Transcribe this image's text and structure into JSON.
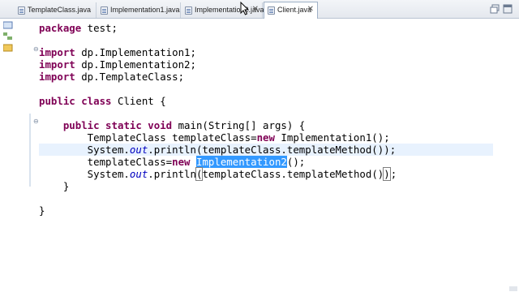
{
  "tabs": [
    {
      "label": "TemplateClass.java",
      "active": false,
      "closable": false
    },
    {
      "label": "Implementation1.java",
      "active": false,
      "closable": false
    },
    {
      "label": "Implementation2.java",
      "active": false,
      "closable": true,
      "close_label": "✕"
    },
    {
      "label": "Client.java",
      "active": true,
      "closable": true,
      "close_label": "✕"
    }
  ],
  "editor": {
    "current_line": 10,
    "selected_text": "Implementation2",
    "lines": [
      {
        "segments": [
          {
            "t": "kw",
            "v": "package"
          },
          {
            "t": "n",
            "v": " test;"
          }
        ]
      },
      {
        "segments": []
      },
      {
        "fold": "⊖",
        "segments": [
          {
            "t": "kw",
            "v": "import"
          },
          {
            "t": "n",
            "v": " dp.Implementation1;"
          }
        ]
      },
      {
        "segments": [
          {
            "t": "kw",
            "v": "import"
          },
          {
            "t": "n",
            "v": " dp.Implementation2;"
          }
        ]
      },
      {
        "segments": [
          {
            "t": "kw",
            "v": "import"
          },
          {
            "t": "n",
            "v": " dp.TemplateClass;"
          }
        ]
      },
      {
        "segments": []
      },
      {
        "segments": [
          {
            "t": "kw",
            "v": "public class"
          },
          {
            "t": "n",
            "v": " Client {"
          }
        ]
      },
      {
        "segments": []
      },
      {
        "fold": "⊖",
        "segments": [
          {
            "t": "n",
            "v": "    "
          },
          {
            "t": "kw",
            "v": "public static void"
          },
          {
            "t": "n",
            "v": " main(String[] args) {"
          }
        ]
      },
      {
        "segments": [
          {
            "t": "n",
            "v": "        TemplateClass templateClass="
          },
          {
            "t": "kw",
            "v": "new"
          },
          {
            "t": "n",
            "v": " Implementation1();"
          }
        ]
      },
      {
        "segments": [
          {
            "t": "n",
            "v": "        System."
          },
          {
            "t": "it",
            "v": "out"
          },
          {
            "t": "n",
            "v": ".println(templateClass.templateMethod());"
          }
        ]
      },
      {
        "segments": [
          {
            "t": "n",
            "v": "        templateClass="
          },
          {
            "t": "kw",
            "v": "new"
          },
          {
            "t": "n",
            "v": " "
          },
          {
            "t": "sel",
            "v": "Implementation2"
          },
          {
            "t": "n",
            "v": "();"
          }
        ]
      },
      {
        "segments": [
          {
            "t": "n",
            "v": "        System."
          },
          {
            "t": "it",
            "v": "out"
          },
          {
            "t": "n",
            "v": ".println"
          },
          {
            "t": "brk",
            "v": "("
          },
          {
            "t": "n",
            "v": "templateClass.templateMethod()"
          },
          {
            "t": "brk",
            "v": ")"
          },
          {
            "t": "cur",
            "v": ""
          },
          {
            "t": "n",
            "v": ";"
          }
        ]
      },
      {
        "segments": [
          {
            "t": "n",
            "v": "    }"
          }
        ]
      },
      {
        "segments": []
      },
      {
        "segments": [
          {
            "t": "n",
            "v": "}"
          }
        ]
      }
    ]
  },
  "colors": {
    "keyword": "#7f0055",
    "static_field": "#0000c0",
    "selection": "#3399ff",
    "current_line": "#e8f2fe"
  },
  "icons": [
    "java-file-icon",
    "close-icon",
    "mouse-cursor-icon",
    "fold-collapse-icon",
    "restore-icon",
    "maximize-icon",
    "package-explorer-icon",
    "hierarchy-icon",
    "outline-icon"
  ]
}
